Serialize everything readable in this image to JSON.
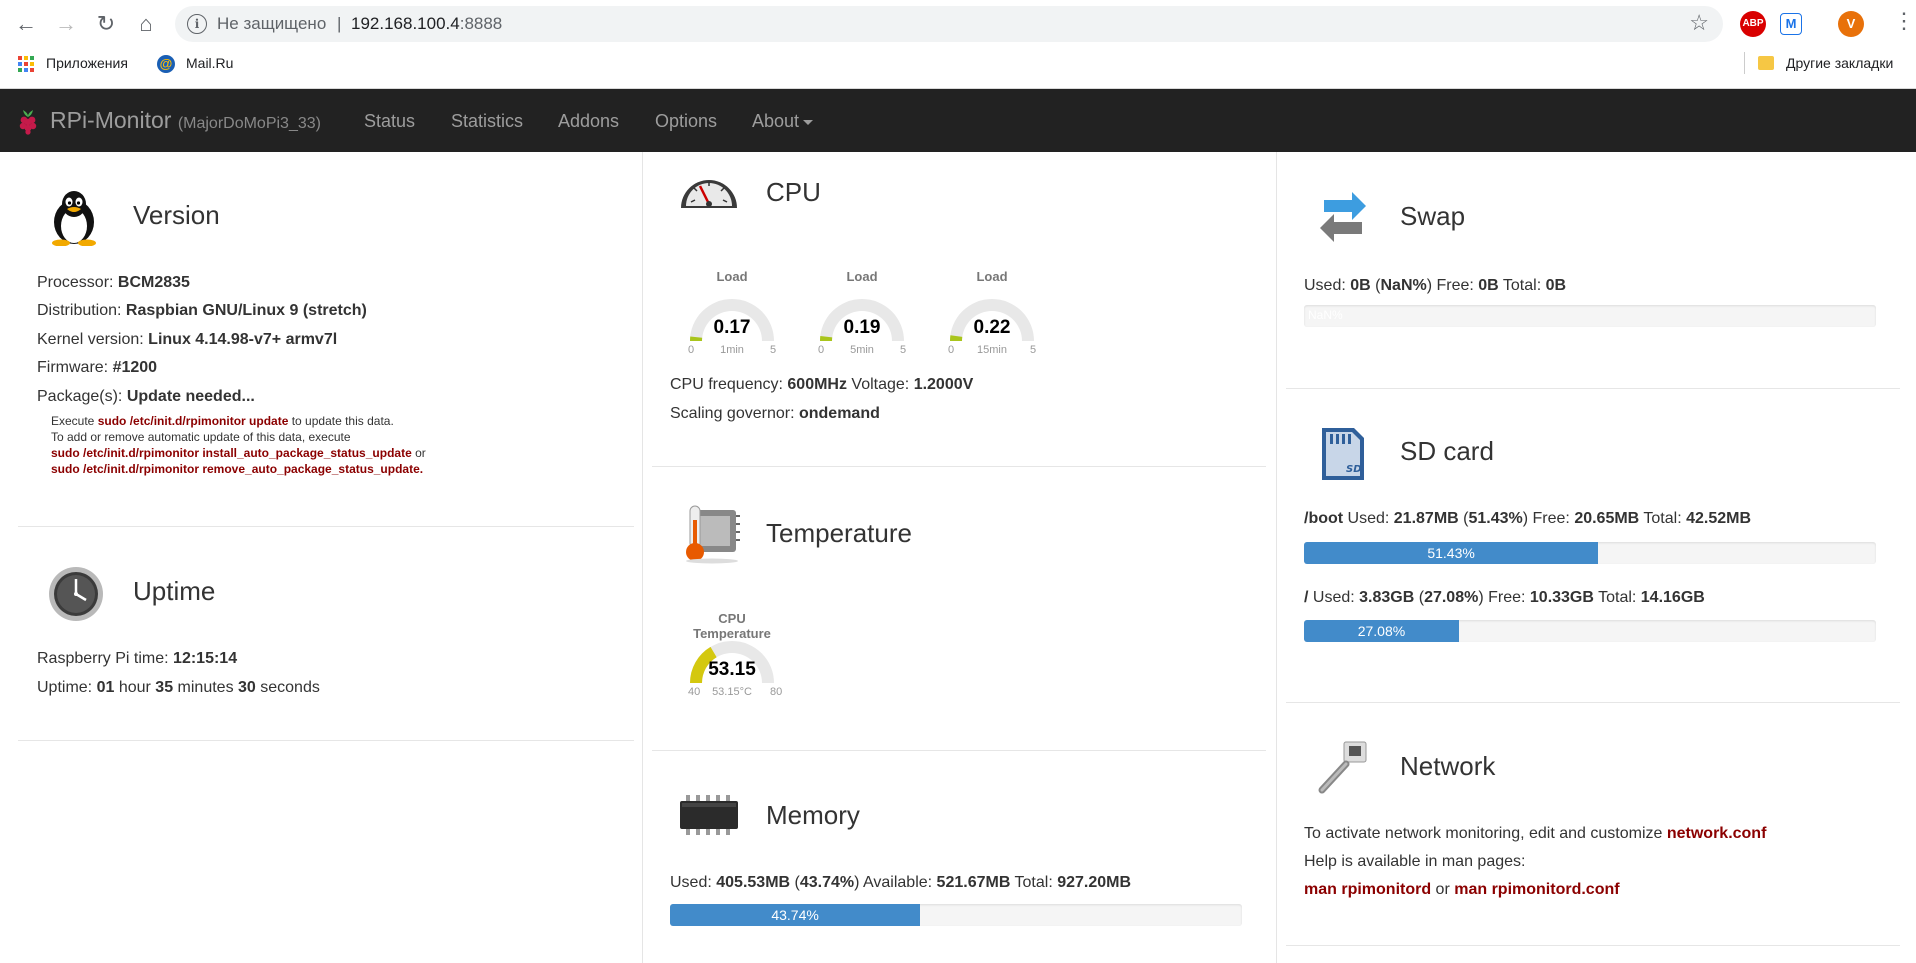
{
  "browser": {
    "insecure_label": "Не защищено",
    "separator": "|",
    "url_host": "192.168.100.4",
    "url_port": ":8888",
    "bookmarks": {
      "apps": "Приложения",
      "mailru": "Mail.Ru",
      "other": "Другие закладки"
    },
    "extensions": {
      "abp": "ABP",
      "m": "M",
      "profile_initial": "V"
    }
  },
  "navbar": {
    "brand": "RPi-Monitor",
    "host": "(MajorDoMoPi3_33)",
    "items": [
      "Status",
      "Statistics",
      "Addons",
      "Options",
      "About"
    ]
  },
  "version": {
    "title": "Version",
    "processor_label": "Processor: ",
    "processor": "BCM2835",
    "distribution_label": "Distribution: ",
    "distribution": "Raspbian GNU/Linux 9 (stretch)",
    "kernel_label": "Kernel version: ",
    "kernel": "Linux 4.14.98-v7+ armv7l",
    "firmware_label": "Firmware: ",
    "firmware": "#1200",
    "packages_label": "Package(s): ",
    "packages": "Update needed...",
    "note1_pre": "Execute ",
    "note1_cmd": "sudo /etc/init.d/rpimonitor update",
    "note1_post": " to update this data.",
    "note2": "To add or remove automatic update of this data, execute",
    "note3_cmd": "sudo /etc/init.d/rpimonitor install_auto_package_status_update",
    "note3_post": " or",
    "note4_cmd": "sudo /etc/init.d/rpimonitor remove_auto_package_status_update."
  },
  "uptime": {
    "title": "Uptime",
    "time_label": "Raspberry Pi time: ",
    "time": "12:15:14",
    "uptime_label": "Uptime: ",
    "hours": "01",
    "hour_word": " hour ",
    "minutes": "35",
    "minute_word": " minutes ",
    "seconds": "30",
    "second_word": " seconds"
  },
  "cpu": {
    "title": "CPU",
    "gauges": [
      {
        "title": "Load",
        "value": "0.17",
        "min": "0",
        "max": "5",
        "label": "1min",
        "fraction": 0.034
      },
      {
        "title": "Load",
        "value": "0.19",
        "min": "0",
        "max": "5",
        "label": "5min",
        "fraction": 0.038
      },
      {
        "title": "Load",
        "value": "0.22",
        "min": "0",
        "max": "5",
        "label": "15min",
        "fraction": 0.044
      }
    ],
    "freq_label": "CPU frequency: ",
    "freq": "600MHz",
    "voltage_label": " Voltage: ",
    "voltage": "1.2000V",
    "governor_label": "Scaling governor: ",
    "governor": "ondemand",
    "gauge_color": "#a9c51c"
  },
  "temperature": {
    "title": "Temperature",
    "gauge": {
      "title": "CPU Temperature",
      "value": "53.15",
      "min": "40",
      "max": "80",
      "label": "53.15°C",
      "fraction": 0.329
    },
    "gauge_color": "#d4c80f"
  },
  "memory": {
    "title": "Memory",
    "used_label": "Used: ",
    "used": "405.53MB",
    "used_pct": "43.74%",
    "avail_label": " Available: ",
    "avail": "521.67MB",
    "total_label": " Total: ",
    "total": "927.20MB",
    "bar_label": "43.74%",
    "fraction": 0.4374
  },
  "swap": {
    "title": "Swap",
    "used_label": "Used: ",
    "used": "0B",
    "used_pct": "NaN%",
    "free_label": " Free: ",
    "free": "0B",
    "total_label": " Total: ",
    "total": "0B",
    "bar_label": "NaN%"
  },
  "sdcard": {
    "title": "SD card",
    "boot_mount": "/boot",
    "boot_used_label": " Used: ",
    "boot_used": "21.87MB",
    "boot_pct": "51.43%",
    "boot_free_label": " Free: ",
    "boot_free": "20.65MB",
    "boot_total_label": " Total: ",
    "boot_total": "42.52MB",
    "boot_bar": "51.43%",
    "boot_fraction": 0.5143,
    "root_mount": "/",
    "root_used_label": " Used: ",
    "root_used": "3.83GB",
    "root_pct": "27.08%",
    "root_free_label": " Free: ",
    "root_free": "10.33GB",
    "root_total_label": " Total: ",
    "root_total": "14.16GB",
    "root_bar": "27.08%",
    "root_fraction": 0.2708
  },
  "network": {
    "title": "Network",
    "line1_pre": "To activate network monitoring, edit and customize ",
    "line1_link": "network.conf",
    "line2": "Help is available in man pages:",
    "man1": "man rpimonitord",
    "or_word": " or ",
    "man2": "man rpimonitord.conf"
  },
  "colors": {
    "accent_red": "#8b0000",
    "progress_blue": "#428bca",
    "navbar_bg": "#222222"
  }
}
